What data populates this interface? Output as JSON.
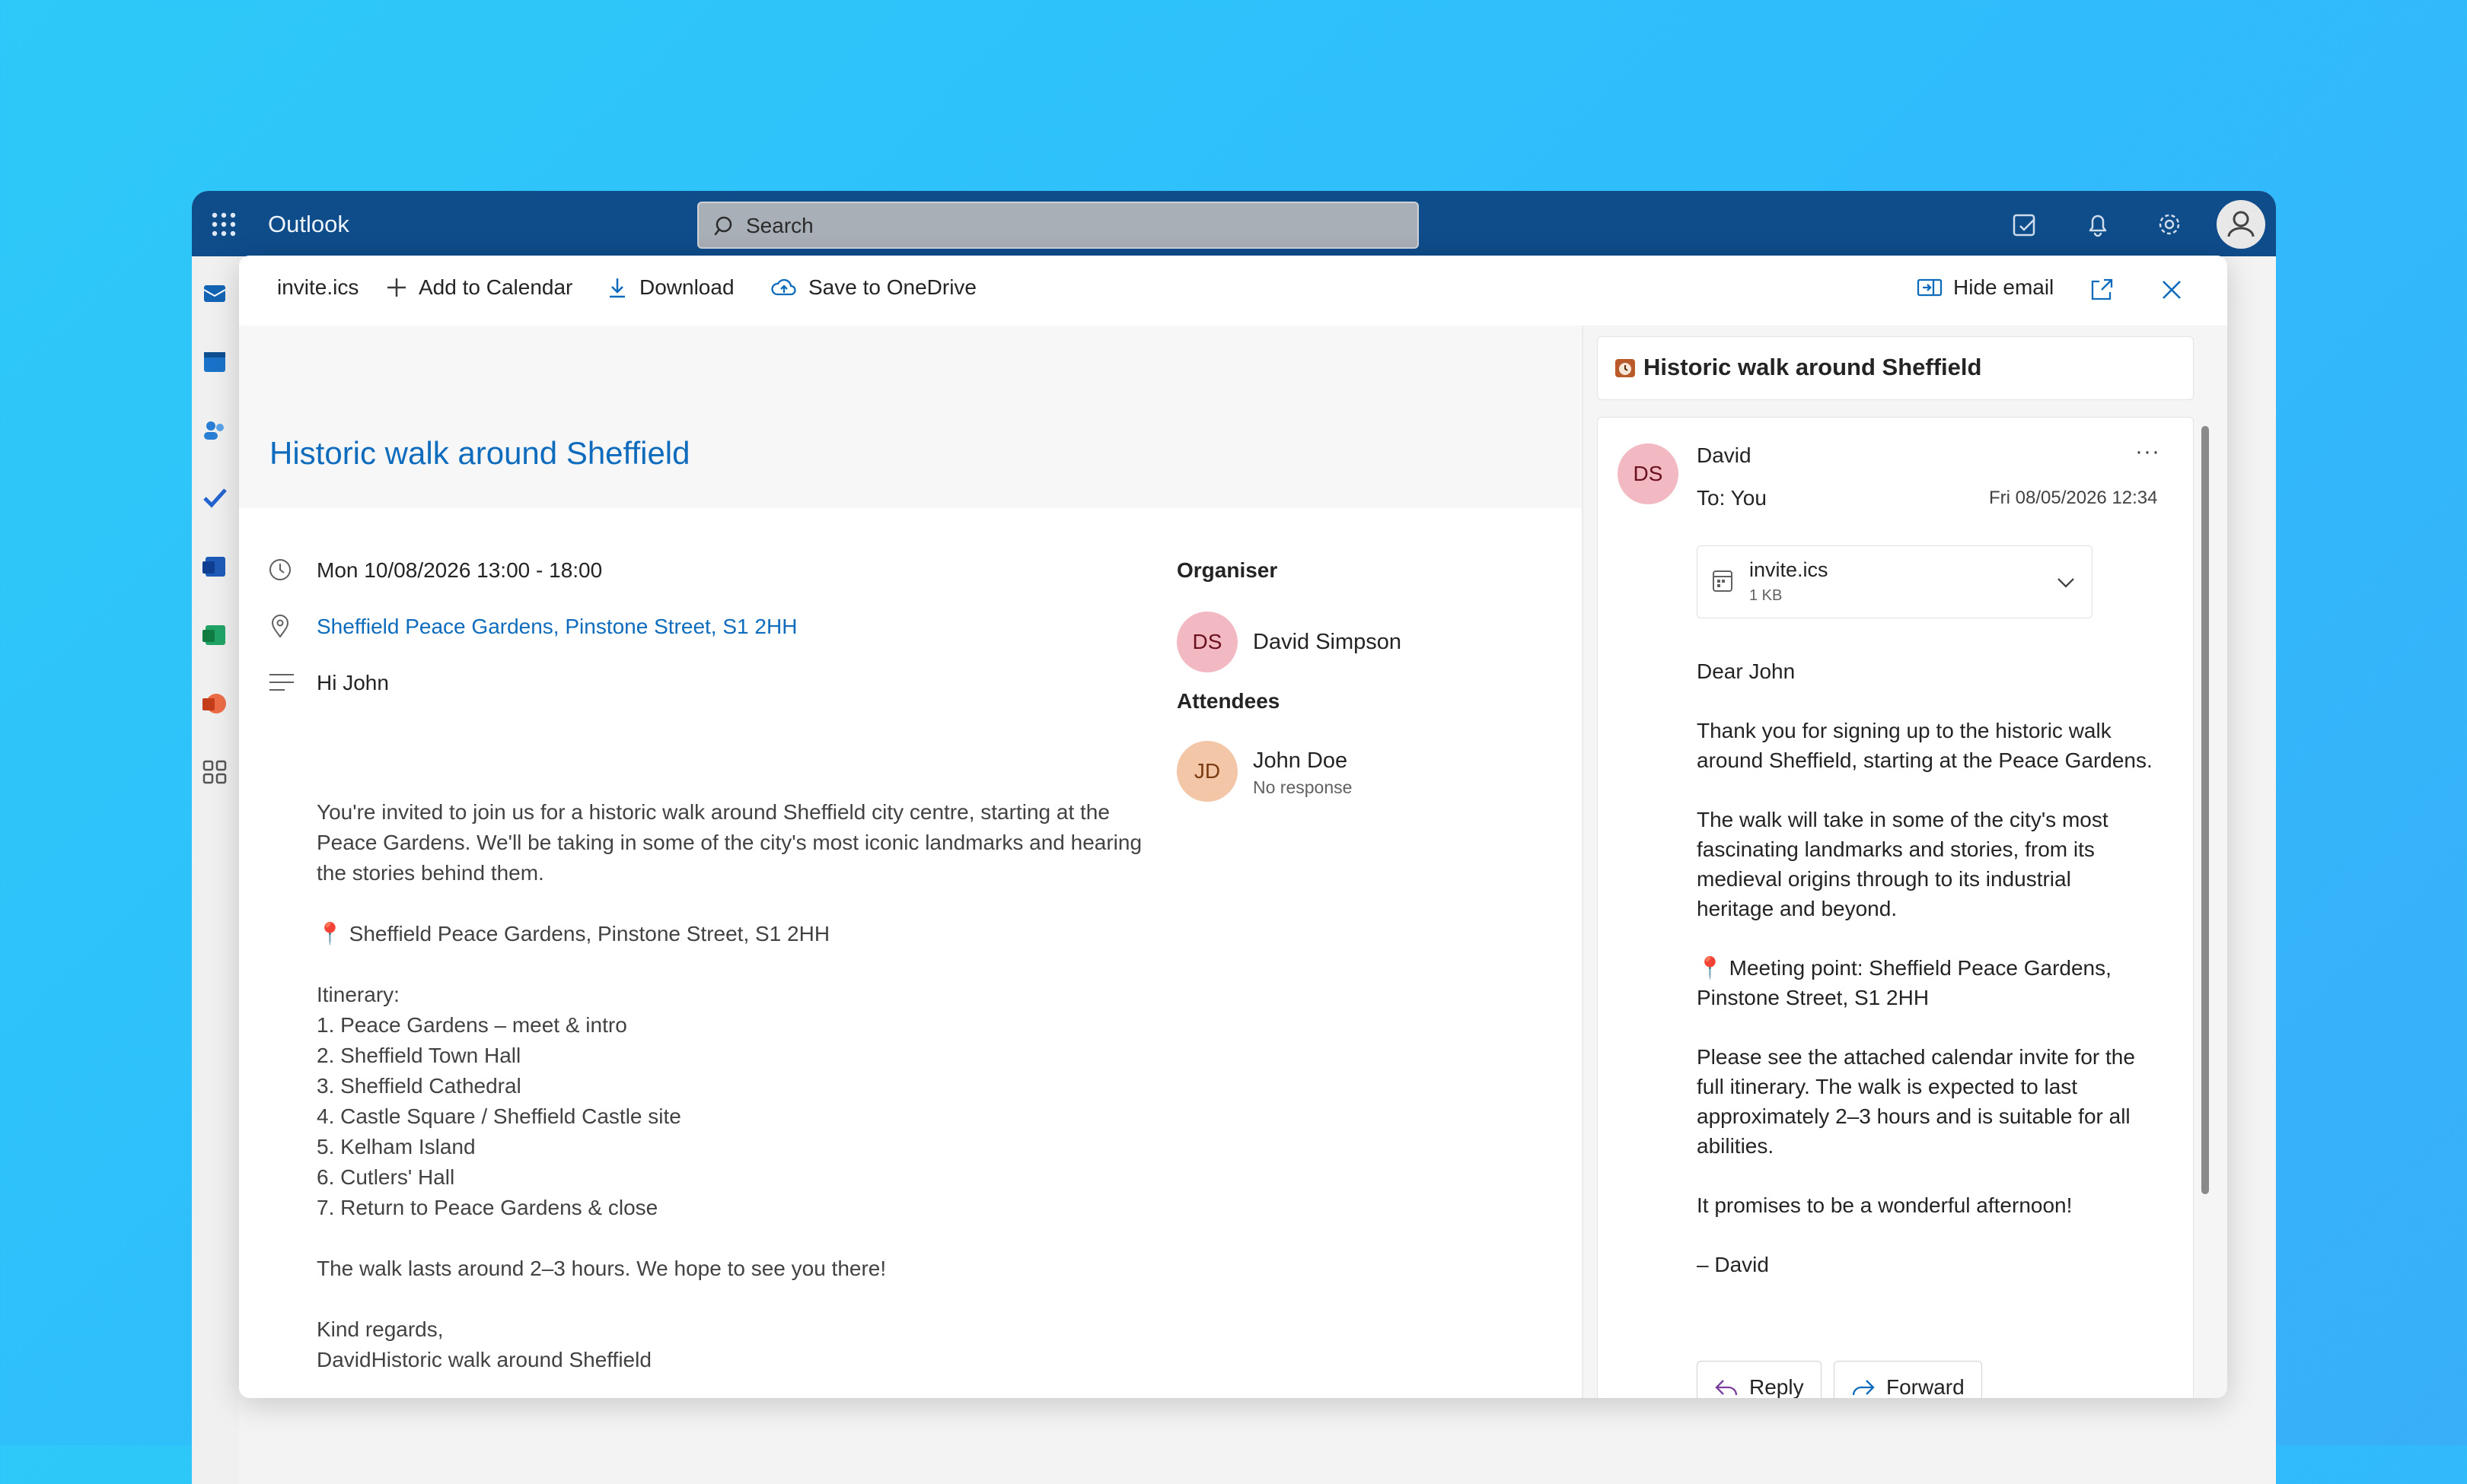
{
  "app": {
    "title": "Outlook"
  },
  "search": {
    "placeholder": "Search"
  },
  "toolbar": {
    "filename": "invite.ics",
    "add_to_calendar": "Add to Calendar",
    "download": "Download",
    "save_onedrive": "Save to OneDrive",
    "hide_email": "Hide email"
  },
  "event": {
    "title": "Historic walk around Sheffield",
    "datetime": "Mon 10/08/2026 13:00 - 18:00",
    "location": "Sheffield Peace Gardens, Pinstone Street, S1 2HH",
    "greeting": "Hi John",
    "body": "You're invited to join us for a historic walk around Sheffield city centre, starting at the Peace Gardens. We'll be taking in some of the city's most iconic landmarks and hearing the stories behind them.\n\n📍 Sheffield Peace Gardens, Pinstone Street, S1 2HH\n\nItinerary:\n1. Peace Gardens – meet & intro\n2. Sheffield Town Hall\n3. Sheffield Cathedral\n4. Castle Square / Sheffield Castle site\n5. Kelham Island\n6. Cutlers' Hall\n7. Return to Peace Gardens & close\n\nThe walk lasts around 2–3 hours. We hope to see you there!\n\nKind regards,\nDavidHistoric walk around Sheffield"
  },
  "organiser": {
    "heading": "Organiser",
    "initials": "DS",
    "name": "David Simpson"
  },
  "attendees": {
    "heading": "Attendees",
    "list": [
      {
        "initials": "JD",
        "name": "John Doe",
        "status": "No response"
      }
    ]
  },
  "email": {
    "subject": "Historic walk around Sheffield",
    "from_initials": "DS",
    "from": "David",
    "to_label": "To:",
    "to": "You",
    "date": "Fri 08/05/2026 12:34",
    "more": "···",
    "attachment": {
      "name": "invite.ics",
      "size": "1 KB"
    },
    "body": "Dear John\n\nThank you for signing up to the historic walk around Sheffield, starting at the Peace Gardens.\n\nThe walk will take in some of the city's most fascinating landmarks and stories, from its medieval origins through to its industrial heritage and beyond.\n\n📍 Meeting point: Sheffield Peace Gardens, Pinstone Street, S1 2HH\n\nPlease see the attached calendar invite for the full itinerary. The walk is expected to last approximately 2–3 hours and is suitable for all abilities.\n\nIt promises to be a wonderful afternoon!\n\n– David",
    "reply": "Reply",
    "forward": "Forward"
  },
  "colors": {
    "brand": "#0f4c8a",
    "link": "#0f6cbd",
    "organiser_avatar": "#f2b9c3",
    "attendee_avatar": "#f3c6a8"
  }
}
